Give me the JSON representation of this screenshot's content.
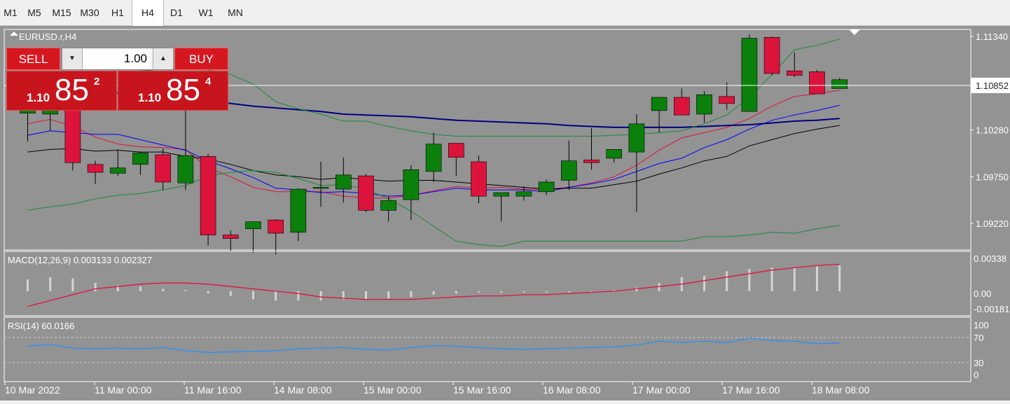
{
  "timeframes": [
    {
      "label": "M1",
      "active": false
    },
    {
      "label": "M5",
      "active": false
    },
    {
      "label": "M15",
      "active": false
    },
    {
      "label": "M30",
      "active": false
    },
    {
      "label": "H1",
      "active": false
    },
    {
      "label": "H4",
      "active": true
    },
    {
      "label": "D1",
      "active": false
    },
    {
      "label": "W1",
      "active": false
    },
    {
      "label": "MN",
      "active": false
    }
  ],
  "chart_title": "EURUSD.r,H4",
  "trade_panel": {
    "sell_label": "SELL",
    "buy_label": "BUY",
    "lot_value": "1.00",
    "sell_price": {
      "prefix": "1.10",
      "big": "85",
      "small": "2"
    },
    "buy_price": {
      "prefix": "1.10",
      "big": "85",
      "small": "4"
    }
  },
  "price_axis": {
    "labels": [
      "1.11340",
      "1.10280",
      "1.09750",
      "1.09220"
    ],
    "current_price": "1.10852"
  },
  "time_axis": {
    "labels": [
      "10 Mar 2022",
      "11 Mar 00:00",
      "11 Mar 16:00",
      "14 Mar 08:00",
      "15 Mar 00:00",
      "15 Mar 16:00",
      "16 Mar 08:00",
      "17 Mar 00:00",
      "17 Mar 16:00",
      "18 Mar 08:00"
    ]
  },
  "macd": {
    "label": "MACD(12,26,9) 0.003133 0.002327",
    "axis": [
      "0.00338",
      "0.00",
      "-0.00181"
    ]
  },
  "rsi": {
    "label": "RSI(14) 60.0166",
    "axis": [
      "100",
      "70",
      "30",
      "0"
    ]
  },
  "colors": {
    "background": "#939393",
    "bull": "#0b800b",
    "bear": "#dc143c",
    "grid": "#ffffff"
  },
  "chart_data": {
    "type": "candlestick",
    "symbol": "EURUSD.r",
    "timeframe": "H4",
    "ylim": [
      1.0892,
      1.1142
    ],
    "candles": [
      {
        "o": 1.1047,
        "h": 1.1077,
        "l": 1.1015,
        "c": 1.1055
      },
      {
        "o": 1.1046,
        "h": 1.1077,
        "l": 1.1027,
        "c": 1.1063
      },
      {
        "o": 1.1063,
        "h": 1.1065,
        "l": 1.0982,
        "c": 1.0991
      },
      {
        "o": 1.0989,
        "h": 1.0993,
        "l": 1.0967,
        "c": 1.098
      },
      {
        "o": 1.0979,
        "h": 1.1006,
        "l": 1.0976,
        "c": 1.0985
      },
      {
        "o": 1.0989,
        "h": 1.1003,
        "l": 1.0977,
        "c": 1.1002
      },
      {
        "o": 1.1,
        "h": 1.1007,
        "l": 1.096,
        "c": 1.0969
      },
      {
        "o": 1.0968,
        "h": 1.1052,
        "l": 1.096,
        "c": 1.0999
      },
      {
        "o": 1.0998,
        "h": 1.1001,
        "l": 1.0897,
        "c": 1.0909
      },
      {
        "o": 1.0909,
        "h": 1.0914,
        "l": 1.089,
        "c": 1.0905
      },
      {
        "o": 1.0916,
        "h": 1.0924,
        "l": 1.0889,
        "c": 1.0924
      },
      {
        "o": 1.0926,
        "h": 1.0927,
        "l": 1.0887,
        "c": 1.0911
      },
      {
        "o": 1.0912,
        "h": 1.0962,
        "l": 1.0902,
        "c": 1.0961
      },
      {
        "o": 1.0962,
        "h": 1.0992,
        "l": 1.0941,
        "c": 1.0963
      },
      {
        "o": 1.0961,
        "h": 1.0997,
        "l": 1.0946,
        "c": 1.0977
      },
      {
        "o": 1.0976,
        "h": 1.0978,
        "l": 1.0935,
        "c": 1.0937
      },
      {
        "o": 1.0937,
        "h": 1.0953,
        "l": 1.0924,
        "c": 1.0948
      },
      {
        "o": 1.0949,
        "h": 1.0988,
        "l": 1.0926,
        "c": 1.0983
      },
      {
        "o": 1.0981,
        "h": 1.1025,
        "l": 1.0969,
        "c": 1.1012
      },
      {
        "o": 1.1013,
        "h": 1.1013,
        "l": 1.0976,
        "c": 1.0997
      },
      {
        "o": 1.0992,
        "h": 1.0999,
        "l": 1.0945,
        "c": 1.0953
      },
      {
        "o": 1.0953,
        "h": 1.0956,
        "l": 1.0924,
        "c": 1.0957
      },
      {
        "o": 1.0953,
        "h": 1.0964,
        "l": 1.0948,
        "c": 1.0958
      },
      {
        "o": 1.0958,
        "h": 1.0972,
        "l": 1.0954,
        "c": 1.0969
      },
      {
        "o": 1.0971,
        "h": 1.1016,
        "l": 1.096,
        "c": 1.0993
      },
      {
        "o": 1.0994,
        "h": 1.103,
        "l": 1.0983,
        "c": 1.0991
      },
      {
        "o": 1.0996,
        "h": 1.1006,
        "l": 1.0991,
        "c": 1.1006
      },
      {
        "o": 1.1003,
        "h": 1.1046,
        "l": 1.0935,
        "c": 1.1035
      },
      {
        "o": 1.105,
        "h": 1.1053,
        "l": 1.1025,
        "c": 1.1065
      },
      {
        "o": 1.1065,
        "h": 1.1075,
        "l": 1.1049,
        "c": 1.1045
      },
      {
        "o": 1.1046,
        "h": 1.1072,
        "l": 1.1036,
        "c": 1.1068
      },
      {
        "o": 1.1066,
        "h": 1.1082,
        "l": 1.1051,
        "c": 1.1058
      },
      {
        "o": 1.1049,
        "h": 1.1136,
        "l": 1.1049,
        "c": 1.1132
      },
      {
        "o": 1.1133,
        "h": 1.1134,
        "l": 1.109,
        "c": 1.1092
      },
      {
        "o": 1.1095,
        "h": 1.1116,
        "l": 1.1088,
        "c": 1.109
      },
      {
        "o": 1.1094,
        "h": 1.1096,
        "l": 1.1071,
        "c": 1.1069
      },
      {
        "o": 1.1075,
        "h": 1.1087,
        "l": 1.1079,
        "c": 1.1085
      }
    ],
    "ma_series": [
      {
        "color": "#dc143c",
        "values": [
          1.1035,
          1.104,
          1.1032,
          1.102,
          1.1012,
          1.1009,
          1.1008,
          1.1006,
          1.0985,
          1.0975,
          1.0963,
          1.0958,
          1.0958,
          1.0958,
          1.0953,
          1.0951,
          1.0951,
          1.0954,
          1.0959,
          1.0964,
          1.0962,
          1.0963,
          1.0961,
          1.0961,
          1.0963,
          1.0968,
          1.0975,
          1.0988,
          1.1005,
          1.1019,
          1.1025,
          1.1031,
          1.1041,
          1.1055,
          1.1066,
          1.1069,
          1.1073
        ]
      },
      {
        "color": "#0000ff",
        "values": [
          1.1022,
          1.1027,
          1.1025,
          1.1023,
          1.1023,
          1.1017,
          1.1011,
          1.1005,
          1.0993,
          1.0984,
          1.0974,
          1.0962,
          1.096,
          1.0957,
          1.0958,
          1.0956,
          1.0953,
          1.0954,
          1.0958,
          1.0962,
          1.096,
          1.096,
          1.096,
          1.0958,
          1.0963,
          1.0967,
          1.0972,
          1.0981,
          1.099,
          1.0996,
          1.1008,
          1.1017,
          1.1029,
          1.1039,
          1.1045,
          1.105,
          1.1056
        ]
      },
      {
        "color": "#000000",
        "values": [
          1.1003,
          1.1006,
          1.1007,
          1.1004,
          1.1005,
          1.1003,
          1.1003,
          1.0998,
          1.0995,
          1.0989,
          1.0982,
          1.0977,
          1.0975,
          1.0972,
          1.0974,
          1.0972,
          1.097,
          1.0971,
          1.0971,
          1.0969,
          1.0967,
          1.0965,
          1.0963,
          1.0961,
          1.0962,
          1.0962,
          1.0966,
          1.097,
          1.0978,
          1.0985,
          1.0993,
          1.0998,
          1.101,
          1.1017,
          1.1024,
          1.1029,
          1.1033
        ]
      },
      {
        "color": "#000080",
        "values": [
          1.1078,
          1.1077,
          1.1075,
          1.1072,
          1.107,
          1.1069,
          1.1066,
          1.1065,
          1.1062,
          1.1058,
          1.1055,
          1.1053,
          1.1051,
          1.1049,
          1.1046,
          1.1045,
          1.1044,
          1.1043,
          1.1041,
          1.1039,
          1.1038,
          1.1037,
          1.1036,
          1.1035,
          1.1033,
          1.1032,
          1.1031,
          1.1031,
          1.1031,
          1.1031,
          1.1032,
          1.1033,
          1.1034,
          1.1036,
          1.1038,
          1.1039,
          1.1041
        ]
      },
      {
        "color": "#1a8a3a",
        "values": [
          1.1083,
          1.1083,
          1.1084,
          1.1091,
          1.1092,
          1.1095,
          1.1097,
          1.1097,
          1.1096,
          1.1091,
          1.108,
          1.106,
          1.1052,
          1.1046,
          1.1038,
          1.1038,
          1.1032,
          1.1027,
          1.1023,
          1.1021,
          1.1021,
          1.1021,
          1.1021,
          1.1021,
          1.1021,
          1.1021,
          1.1022,
          1.1023,
          1.1025,
          1.1027,
          1.1035,
          1.1045,
          1.1065,
          1.1091,
          1.1119,
          1.1124,
          1.1131
        ]
      },
      {
        "color": "#1a8a3a",
        "values": [
          1.0937,
          1.0941,
          1.0944,
          1.095,
          1.0954,
          1.0956,
          1.096,
          1.0965,
          1.0976,
          1.098,
          1.0982,
          1.098,
          1.0973,
          1.0965,
          1.0966,
          1.0961,
          1.095,
          1.0936,
          1.0919,
          1.0902,
          1.0898,
          1.0896,
          1.0902,
          1.0902,
          1.0902,
          1.0902,
          1.0902,
          1.0902,
          1.0902,
          1.0902,
          1.0907,
          1.0907,
          1.0909,
          1.0912,
          1.0911,
          1.0916,
          1.092
        ]
      }
    ],
    "macd": {
      "ylim": [
        -0.0021,
        0.0034
      ],
      "hist": [
        0.001,
        0.0012,
        0.0011,
        0.0007,
        0.0005,
        0.0004,
        0.0002,
        0.0001,
        -0.0002,
        -0.0004,
        -0.0007,
        -0.0008,
        -0.0008,
        -0.0008,
        -0.0007,
        -0.0007,
        -0.0006,
        -0.0005,
        -0.0003,
        -0.0002,
        -0.0001,
        -0.0001,
        -0.0001,
        -0.0001,
        -0.0001,
        0.0,
        0.0001,
        0.0003,
        0.0007,
        0.0012,
        0.0013,
        0.0017,
        0.0019,
        0.002,
        0.002,
        0.0021,
        0.0022
      ],
      "signal": [
        -0.0013,
        -0.0008,
        -0.0003,
        0.0002,
        0.0004,
        0.0006,
        0.0007,
        0.0007,
        0.0006,
        0.0004,
        0.0002,
        0.0,
        -0.0002,
        -0.0005,
        -0.0006,
        -0.0007,
        -0.0007,
        -0.0007,
        -0.0006,
        -0.0005,
        -0.0004,
        -0.0004,
        -0.0003,
        -0.0003,
        -0.0002,
        -0.0001,
        0.0,
        0.0002,
        0.0004,
        0.0006,
        0.0009,
        0.0012,
        0.0015,
        0.0018,
        0.002,
        0.0022,
        0.0023
      ]
    },
    "rsi": {
      "ylim": [
        0,
        100
      ],
      "values": [
        55,
        58,
        52,
        51,
        52,
        51,
        53,
        48,
        45,
        46,
        47,
        48,
        51,
        52,
        53,
        50,
        49,
        53,
        56,
        55,
        53,
        51,
        50,
        51,
        52,
        53,
        54,
        57,
        63,
        61,
        63,
        61,
        68,
        64,
        63,
        59,
        60
      ]
    }
  }
}
